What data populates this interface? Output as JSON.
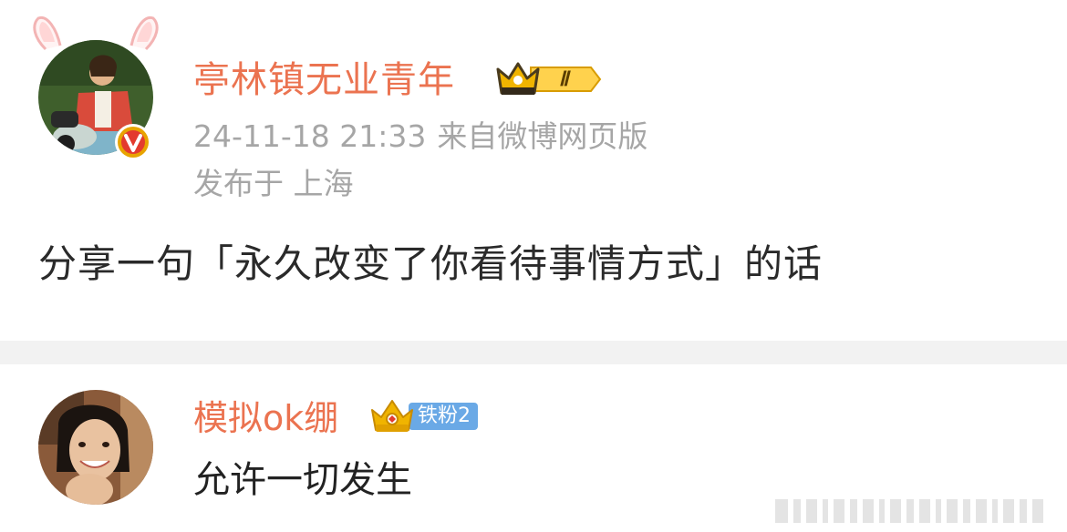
{
  "post": {
    "author_name": "亭林镇无业青年",
    "vip_level": "Ⅱ",
    "timestamp": "24-11-18 21:33",
    "source": "来自微博网页版",
    "location": "发布于 上海",
    "text": "分享一句「永久改变了你看待事情方式」的话"
  },
  "comment": {
    "name": "模拟ok绷",
    "fan_badge": "铁粉2",
    "text": "允许一切发生"
  },
  "icons": {
    "verify": "verified-v-icon",
    "vip": "crown-vip-badge-icon",
    "fan": "crown-fan-badge-icon",
    "ears": "bunny-ears-decoration"
  },
  "colors": {
    "name": "#eb7350",
    "meta": "#a6a6a6",
    "text": "#2a2a2a",
    "divider": "#f2f2f2",
    "verify": "#e8a400",
    "fan_pill": "#6aa9e6"
  }
}
